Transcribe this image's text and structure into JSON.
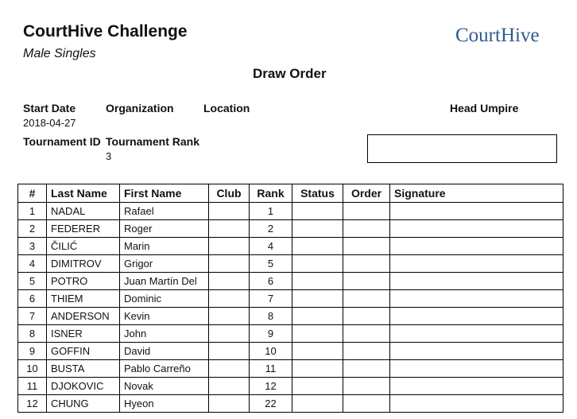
{
  "header": {
    "title": "CourtHive Challenge",
    "subtitle": "Male Singles",
    "logo_text": "CourtHive",
    "doc_heading": "Draw Order"
  },
  "info": {
    "start_date_label": "Start Date",
    "start_date_value": "2018-04-27",
    "organization_label": "Organization",
    "location_label": "Location",
    "head_umpire_label": "Head Umpire",
    "tournament_id_label": "Tournament ID",
    "tournament_rank_label": "Tournament Rank",
    "tournament_rank_value": "3"
  },
  "table": {
    "columns": [
      "#",
      "Last Name",
      "First Name",
      "Club",
      "Rank",
      "Status",
      "Order",
      "Signature"
    ],
    "rows": [
      {
        "num": "1",
        "last": "NADAL",
        "first": "Rafael",
        "rank": "1"
      },
      {
        "num": "2",
        "last": "FEDERER",
        "first": "Roger",
        "rank": "2"
      },
      {
        "num": "3",
        "last": "ČILIĆ",
        "first": "Marin",
        "rank": "4"
      },
      {
        "num": "4",
        "last": "DIMITROV",
        "first": "Grigor",
        "rank": "5"
      },
      {
        "num": "5",
        "last": "POTRO",
        "first": "Juan Martín Del",
        "rank": "6"
      },
      {
        "num": "6",
        "last": "THIEM",
        "first": "Dominic",
        "rank": "7"
      },
      {
        "num": "7",
        "last": "ANDERSON",
        "first": "Kevin",
        "rank": "8"
      },
      {
        "num": "8",
        "last": "ISNER",
        "first": "John",
        "rank": "9"
      },
      {
        "num": "9",
        "last": "GOFFIN",
        "first": "David",
        "rank": "10"
      },
      {
        "num": "10",
        "last": "BUSTA",
        "first": "Pablo Carreño",
        "rank": "11"
      },
      {
        "num": "11",
        "last": "DJOKOVIC",
        "first": "Novak",
        "rank": "12"
      },
      {
        "num": "12",
        "last": "CHUNG",
        "first": "Hyeon",
        "rank": "22"
      }
    ]
  },
  "colors": {
    "logo": "#2f5b8f",
    "text": "#111111",
    "border": "#000000"
  }
}
